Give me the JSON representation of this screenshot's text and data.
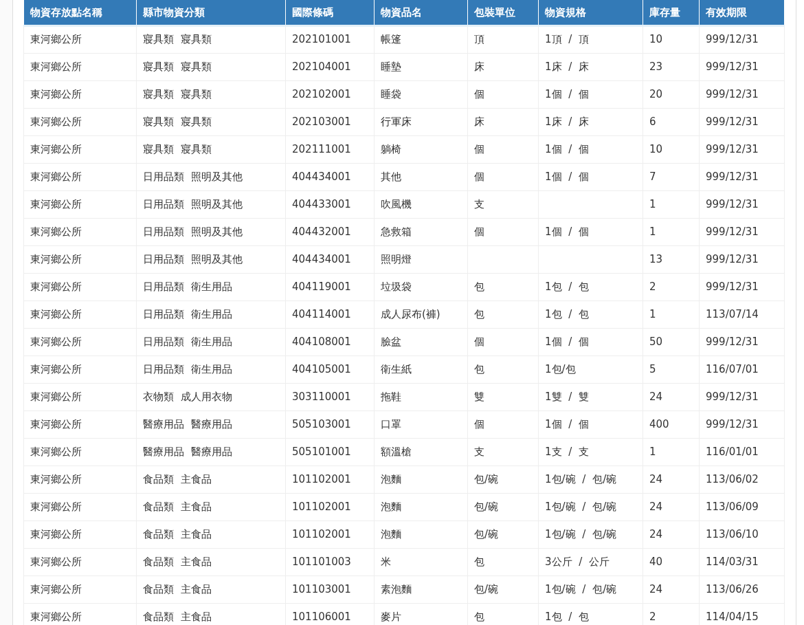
{
  "table": {
    "columns": [
      "物資存放點名稱",
      "縣市物資分類",
      "國際條碼",
      "物資品名",
      "包裝單位",
      "物資規格",
      "庫存量",
      "有效期限"
    ],
    "rows": [
      [
        "東河鄉公所",
        "寢具類 寢具類",
        "202101001",
        "帳篷",
        "頂",
        "1頂 / 頂",
        "10",
        "999/12/31"
      ],
      [
        "東河鄉公所",
        "寢具類 寢具類",
        "202104001",
        "睡墊",
        "床",
        "1床 / 床",
        "23",
        "999/12/31"
      ],
      [
        "東河鄉公所",
        "寢具類 寢具類",
        "202102001",
        "睡袋",
        "個",
        "1個 / 個",
        "20",
        "999/12/31"
      ],
      [
        "東河鄉公所",
        "寢具類 寢具類",
        "202103001",
        "行軍床",
        "床",
        "1床 / 床",
        "6",
        "999/12/31"
      ],
      [
        "東河鄉公所",
        "寢具類 寢具類",
        "202111001",
        "躺椅",
        "個",
        "1個 / 個",
        "10",
        "999/12/31"
      ],
      [
        "東河鄉公所",
        "日用品類 照明及其他",
        "404434001",
        "其他",
        "個",
        "1個 / 個",
        "7",
        "999/12/31"
      ],
      [
        "東河鄉公所",
        "日用品類 照明及其他",
        "404433001",
        "吹風機",
        "支",
        "",
        "1",
        "999/12/31"
      ],
      [
        "東河鄉公所",
        "日用品類 照明及其他",
        "404432001",
        "急救箱",
        "個",
        "1個 / 個",
        "1",
        "999/12/31"
      ],
      [
        "東河鄉公所",
        "日用品類 照明及其他",
        "404434001",
        "照明燈",
        "",
        "",
        "13",
        "999/12/31"
      ],
      [
        "東河鄉公所",
        "日用品類 衛生用品",
        "404119001",
        "垃圾袋",
        "包",
        "1包 / 包",
        "2",
        "999/12/31"
      ],
      [
        "東河鄉公所",
        "日用品類 衛生用品",
        "404114001",
        "成人尿布(褲)",
        "包",
        "1包 / 包",
        "1",
        "113/07/14"
      ],
      [
        "東河鄉公所",
        "日用品類 衛生用品",
        "404108001",
        "臉盆",
        "個",
        "1個 / 個",
        "50",
        "999/12/31"
      ],
      [
        "東河鄉公所",
        "日用品類 衛生用品",
        "404105001",
        "衛生紙",
        "包",
        "1包/包",
        "5",
        "116/07/01"
      ],
      [
        "東河鄉公所",
        "衣物類 成人用衣物",
        "303110001",
        "拖鞋",
        "雙",
        "1雙 / 雙",
        "24",
        "999/12/31"
      ],
      [
        "東河鄉公所",
        "醫療用品 醫療用品",
        "505103001",
        "口罩",
        "個",
        "1個 / 個",
        "400",
        "999/12/31"
      ],
      [
        "東河鄉公所",
        "醫療用品 醫療用品",
        "505101001",
        "額溫槍",
        "支",
        "1支 / 支",
        "1",
        "116/01/01"
      ],
      [
        "東河鄉公所",
        "食品類 主食品",
        "101102001",
        "泡麵",
        "包/碗",
        "1包/碗 / 包/碗",
        "24",
        "113/06/02"
      ],
      [
        "東河鄉公所",
        "食品類 主食品",
        "101102001",
        "泡麵",
        "包/碗",
        "1包/碗 / 包/碗",
        "24",
        "113/06/09"
      ],
      [
        "東河鄉公所",
        "食品類 主食品",
        "101102001",
        "泡麵",
        "包/碗",
        "1包/碗 / 包/碗",
        "24",
        "113/06/10"
      ],
      [
        "東河鄉公所",
        "食品類 主食品",
        "101101003",
        "米",
        "包",
        "3公斤 / 公斤",
        "40",
        "114/03/31"
      ],
      [
        "東河鄉公所",
        "食品類 主食品",
        "101103001",
        "素泡麵",
        "包/碗",
        "1包/碗 / 包/碗",
        "24",
        "113/06/26"
      ],
      [
        "東河鄉公所",
        "食品類 主食品",
        "101106001",
        "麥片",
        "包",
        "1包 / 包",
        "2",
        "114/04/15"
      ]
    ]
  }
}
